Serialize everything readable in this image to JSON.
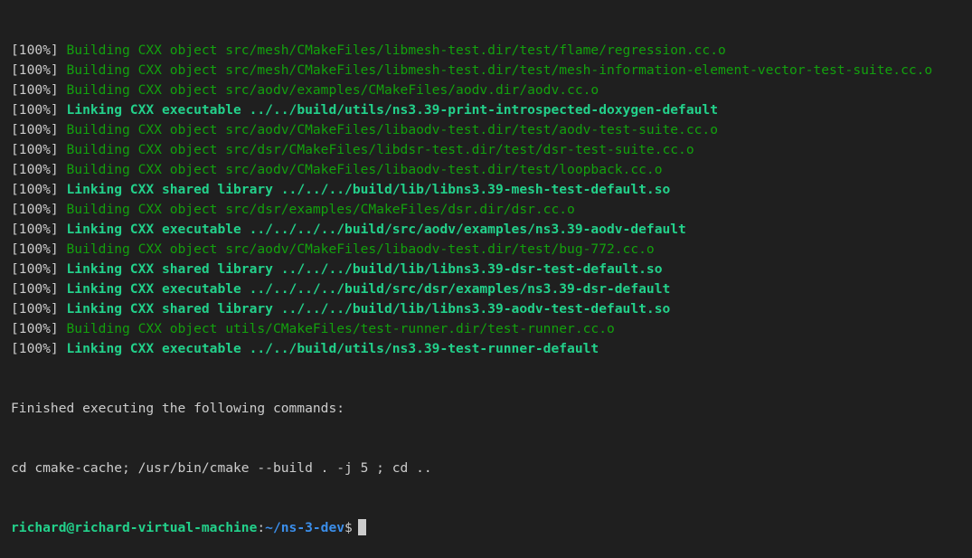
{
  "terminal": {
    "build_lines": [
      {
        "pct": "[100%] ",
        "text": "Building CXX object src/mesh/CMakeFiles/libmesh-test.dir/test/flame/regression.cc.o",
        "kind": "build"
      },
      {
        "pct": "[100%] ",
        "text": "Building CXX object src/mesh/CMakeFiles/libmesh-test.dir/test/mesh-information-element-vector-test-suite.cc.o",
        "kind": "build"
      },
      {
        "pct": "[100%] ",
        "text": "Building CXX object src/aodv/examples/CMakeFiles/aodv.dir/aodv.cc.o",
        "kind": "build"
      },
      {
        "pct": "[100%] ",
        "text": "Linking CXX executable ../../build/utils/ns3.39-print-introspected-doxygen-default",
        "kind": "link"
      },
      {
        "pct": "[100%] ",
        "text": "Building CXX object src/aodv/CMakeFiles/libaodv-test.dir/test/aodv-test-suite.cc.o",
        "kind": "build"
      },
      {
        "pct": "[100%] ",
        "text": "Building CXX object src/dsr/CMakeFiles/libdsr-test.dir/test/dsr-test-suite.cc.o",
        "kind": "build"
      },
      {
        "pct": "[100%] ",
        "text": "Building CXX object src/aodv/CMakeFiles/libaodv-test.dir/test/loopback.cc.o",
        "kind": "build"
      },
      {
        "pct": "[100%] ",
        "text": "Linking CXX shared library ../../../build/lib/libns3.39-mesh-test-default.so",
        "kind": "link"
      },
      {
        "pct": "[100%] ",
        "text": "Building CXX object src/dsr/examples/CMakeFiles/dsr.dir/dsr.cc.o",
        "kind": "build"
      },
      {
        "pct": "[100%] ",
        "text": "Linking CXX executable ../../../../build/src/aodv/examples/ns3.39-aodv-default",
        "kind": "link"
      },
      {
        "pct": "[100%] ",
        "text": "Building CXX object src/aodv/CMakeFiles/libaodv-test.dir/test/bug-772.cc.o",
        "kind": "build"
      },
      {
        "pct": "[100%] ",
        "text": "Linking CXX shared library ../../../build/lib/libns3.39-dsr-test-default.so",
        "kind": "link"
      },
      {
        "pct": "[100%] ",
        "text": "Linking CXX executable ../../../../build/src/dsr/examples/ns3.39-dsr-default",
        "kind": "link"
      },
      {
        "pct": "[100%] ",
        "text": "Linking CXX shared library ../../../build/lib/libns3.39-aodv-test-default.so",
        "kind": "link"
      },
      {
        "pct": "[100%] ",
        "text": "Building CXX object utils/CMakeFiles/test-runner.dir/test-runner.cc.o",
        "kind": "build"
      },
      {
        "pct": "[100%] ",
        "text": "Linking CXX executable ../../build/utils/ns3.39-test-runner-default",
        "kind": "link"
      }
    ],
    "finished_text": "Finished executing the following commands:",
    "command_text": "cd cmake-cache; /usr/bin/cmake --build . -j 5 ; cd ..",
    "prompt": {
      "user_host": "richard@richard-virtual-machine",
      "colon": ":",
      "path": "~/ns-3-dev",
      "dollar": "$"
    }
  },
  "colors": {
    "background": "#1f1f1f",
    "default_text": "#cccccc",
    "build_text": "#13a10e",
    "link_text": "#23d18b",
    "path_text": "#3b8eea"
  }
}
